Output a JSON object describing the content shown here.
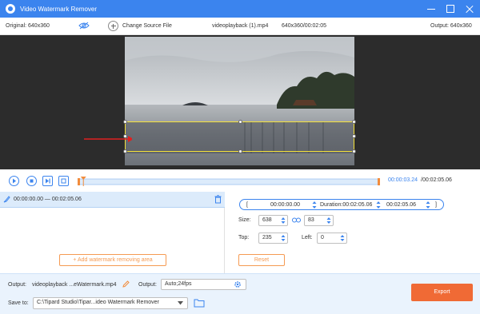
{
  "window": {
    "title": "Video Watermark Remover"
  },
  "info": {
    "original": "Original: 640x360",
    "change_source": "Change Source File",
    "filename": "videoplayback (1).mp4",
    "resolution_time": "640x360/00:02:05",
    "output": "Output: 640x360"
  },
  "playback": {
    "current": "00:00:03.24",
    "total": "/00:02:05.06",
    "progress": 0.014
  },
  "segment": {
    "range": "00:00:00.00 — 00:02:05.06"
  },
  "time_range": {
    "start": "00:00:00.00",
    "duration": "Duration:00:02:05.06",
    "end": "00:02:05.06"
  },
  "area": {
    "size_label": "Size:",
    "width": "638",
    "height": "83",
    "top_label": "Top:",
    "top": "235",
    "left_label": "Left:",
    "left": "0",
    "reset": "Reset"
  },
  "add_area": "Add watermark removing area",
  "output": {
    "label": "Output:",
    "filename": "videoplayback ...eWatermark.mp4",
    "format_label": "Output:",
    "format": "Auto;24fps",
    "save_label": "Save to:",
    "save_path": "C:\\Tipard Studio\\Tipar...ideo Watermark Remover"
  },
  "export": "Export",
  "colors": {
    "accent": "#3b84ee",
    "orange": "#f06a35"
  }
}
